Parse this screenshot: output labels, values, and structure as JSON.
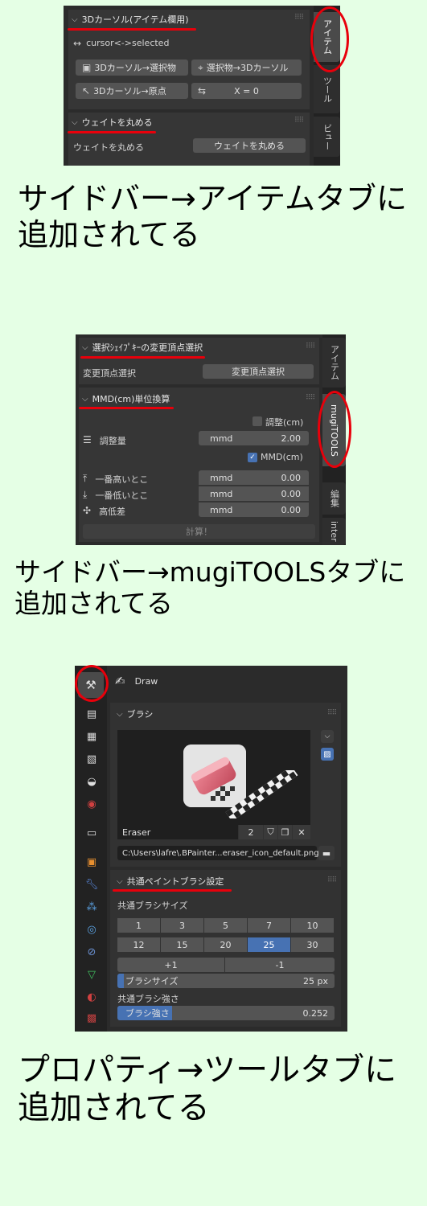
{
  "colors": {
    "background": "#e5ffe5",
    "panel": "#2b2b2b",
    "accent_blue": "#4772b3",
    "annotation_red": "#e8000b"
  },
  "shot1": {
    "section1_title": "3Dカーソル(アイテム欄用)",
    "row_label": "cursor<->selected",
    "btn_cursor_to_selected": "3Dカーソル→選択物",
    "btn_selected_to_cursor": "選択物→3Dカーソル",
    "btn_cursor_to_origin": "3Dカーソル→原点",
    "btn_x_zero": "X = 0",
    "section2_title": "ウェイトを丸める",
    "weight_label": "ウェイトを丸める",
    "weight_button": "ウェイトを丸める",
    "tabs": [
      "アイテム",
      "ツール",
      "ビュー"
    ]
  },
  "caption1": {
    "line1": "サイドバー→アイテムタブに",
    "line2": "追加されてる"
  },
  "shot2": {
    "section1_title": "選択ｼｪｲﾌﾟｷｰの変更頂点選択",
    "row_label": "変更頂点選択",
    "row_button": "変更頂点選択",
    "section2_title": "MMD(cm)単位換算",
    "check_cm": "調整(cm)",
    "adjust_label": "調整量",
    "adjust_unit": "mmd",
    "adjust_value": "2.00",
    "check_mmd": "MMD(cm)",
    "rows": [
      {
        "label": "一番高いとこ",
        "unit": "mmd",
        "value": "0.00"
      },
      {
        "label": "一番低いとこ",
        "unit": "mmd",
        "value": "0.00"
      },
      {
        "label": "高低差",
        "unit": "mmd",
        "value": "0.00"
      }
    ],
    "calc_button": "計算！",
    "tabs": [
      "アイテム",
      "mugiTOOLS",
      "編集",
      "inter"
    ]
  },
  "caption2": {
    "line1": "サイドバー→mugiTOOLSタブに",
    "line2": "追加されてる"
  },
  "shot3": {
    "tool_name": "Draw",
    "section1_title": "ブラシ",
    "brush_name": "Eraser",
    "brush_users": "2",
    "brush_path": "C:\\Users\\lafre\\.BPainter...eraser_icon_default.png",
    "section2_title": "共通ペイントブラシ設定",
    "size_label": "共通ブラシサイズ",
    "sizes_row1": [
      "1",
      "3",
      "5",
      "7",
      "10"
    ],
    "sizes_row2": [
      "12",
      "15",
      "20",
      "25",
      "30"
    ],
    "selected_size": "25",
    "plus_button": "+1",
    "minus_button": "-1",
    "brush_size_label": "ブラシサイズ",
    "brush_size_value": "25 px",
    "brush_size_fill": 0.03,
    "strength_label": "共通ブラシ強さ",
    "strength_field_label": "ブラシ強さ",
    "strength_value": "0.252",
    "strength_fill": 0.252
  },
  "caption3": {
    "line1": "プロパティ→ツールタブに",
    "line2": "追加されてる"
  }
}
